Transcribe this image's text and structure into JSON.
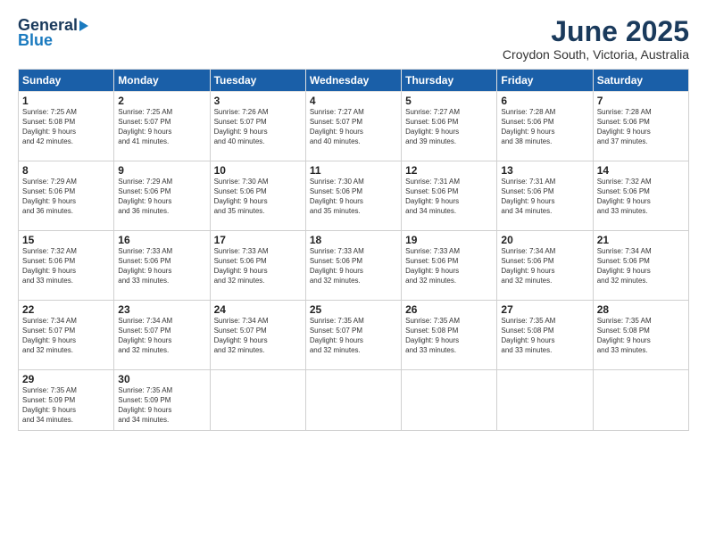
{
  "logo": {
    "general": "General",
    "blue": "Blue"
  },
  "title": "June 2025",
  "location": "Croydon South, Victoria, Australia",
  "days_of_week": [
    "Sunday",
    "Monday",
    "Tuesday",
    "Wednesday",
    "Thursday",
    "Friday",
    "Saturday"
  ],
  "weeks": [
    [
      {
        "num": "1",
        "info": "Sunrise: 7:25 AM\nSunset: 5:08 PM\nDaylight: 9 hours\nand 42 minutes."
      },
      {
        "num": "2",
        "info": "Sunrise: 7:25 AM\nSunset: 5:07 PM\nDaylight: 9 hours\nand 41 minutes."
      },
      {
        "num": "3",
        "info": "Sunrise: 7:26 AM\nSunset: 5:07 PM\nDaylight: 9 hours\nand 40 minutes."
      },
      {
        "num": "4",
        "info": "Sunrise: 7:27 AM\nSunset: 5:07 PM\nDaylight: 9 hours\nand 40 minutes."
      },
      {
        "num": "5",
        "info": "Sunrise: 7:27 AM\nSunset: 5:06 PM\nDaylight: 9 hours\nand 39 minutes."
      },
      {
        "num": "6",
        "info": "Sunrise: 7:28 AM\nSunset: 5:06 PM\nDaylight: 9 hours\nand 38 minutes."
      },
      {
        "num": "7",
        "info": "Sunrise: 7:28 AM\nSunset: 5:06 PM\nDaylight: 9 hours\nand 37 minutes."
      }
    ],
    [
      {
        "num": "8",
        "info": "Sunrise: 7:29 AM\nSunset: 5:06 PM\nDaylight: 9 hours\nand 36 minutes."
      },
      {
        "num": "9",
        "info": "Sunrise: 7:29 AM\nSunset: 5:06 PM\nDaylight: 9 hours\nand 36 minutes."
      },
      {
        "num": "10",
        "info": "Sunrise: 7:30 AM\nSunset: 5:06 PM\nDaylight: 9 hours\nand 35 minutes."
      },
      {
        "num": "11",
        "info": "Sunrise: 7:30 AM\nSunset: 5:06 PM\nDaylight: 9 hours\nand 35 minutes."
      },
      {
        "num": "12",
        "info": "Sunrise: 7:31 AM\nSunset: 5:06 PM\nDaylight: 9 hours\nand 34 minutes."
      },
      {
        "num": "13",
        "info": "Sunrise: 7:31 AM\nSunset: 5:06 PM\nDaylight: 9 hours\nand 34 minutes."
      },
      {
        "num": "14",
        "info": "Sunrise: 7:32 AM\nSunset: 5:06 PM\nDaylight: 9 hours\nand 33 minutes."
      }
    ],
    [
      {
        "num": "15",
        "info": "Sunrise: 7:32 AM\nSunset: 5:06 PM\nDaylight: 9 hours\nand 33 minutes."
      },
      {
        "num": "16",
        "info": "Sunrise: 7:33 AM\nSunset: 5:06 PM\nDaylight: 9 hours\nand 33 minutes."
      },
      {
        "num": "17",
        "info": "Sunrise: 7:33 AM\nSunset: 5:06 PM\nDaylight: 9 hours\nand 32 minutes."
      },
      {
        "num": "18",
        "info": "Sunrise: 7:33 AM\nSunset: 5:06 PM\nDaylight: 9 hours\nand 32 minutes."
      },
      {
        "num": "19",
        "info": "Sunrise: 7:33 AM\nSunset: 5:06 PM\nDaylight: 9 hours\nand 32 minutes."
      },
      {
        "num": "20",
        "info": "Sunrise: 7:34 AM\nSunset: 5:06 PM\nDaylight: 9 hours\nand 32 minutes."
      },
      {
        "num": "21",
        "info": "Sunrise: 7:34 AM\nSunset: 5:06 PM\nDaylight: 9 hours\nand 32 minutes."
      }
    ],
    [
      {
        "num": "22",
        "info": "Sunrise: 7:34 AM\nSunset: 5:07 PM\nDaylight: 9 hours\nand 32 minutes."
      },
      {
        "num": "23",
        "info": "Sunrise: 7:34 AM\nSunset: 5:07 PM\nDaylight: 9 hours\nand 32 minutes."
      },
      {
        "num": "24",
        "info": "Sunrise: 7:34 AM\nSunset: 5:07 PM\nDaylight: 9 hours\nand 32 minutes."
      },
      {
        "num": "25",
        "info": "Sunrise: 7:35 AM\nSunset: 5:07 PM\nDaylight: 9 hours\nand 32 minutes."
      },
      {
        "num": "26",
        "info": "Sunrise: 7:35 AM\nSunset: 5:08 PM\nDaylight: 9 hours\nand 33 minutes."
      },
      {
        "num": "27",
        "info": "Sunrise: 7:35 AM\nSunset: 5:08 PM\nDaylight: 9 hours\nand 33 minutes."
      },
      {
        "num": "28",
        "info": "Sunrise: 7:35 AM\nSunset: 5:08 PM\nDaylight: 9 hours\nand 33 minutes."
      }
    ],
    [
      {
        "num": "29",
        "info": "Sunrise: 7:35 AM\nSunset: 5:09 PM\nDaylight: 9 hours\nand 34 minutes."
      },
      {
        "num": "30",
        "info": "Sunrise: 7:35 AM\nSunset: 5:09 PM\nDaylight: 9 hours\nand 34 minutes."
      },
      {
        "num": "",
        "info": ""
      },
      {
        "num": "",
        "info": ""
      },
      {
        "num": "",
        "info": ""
      },
      {
        "num": "",
        "info": ""
      },
      {
        "num": "",
        "info": ""
      }
    ]
  ]
}
